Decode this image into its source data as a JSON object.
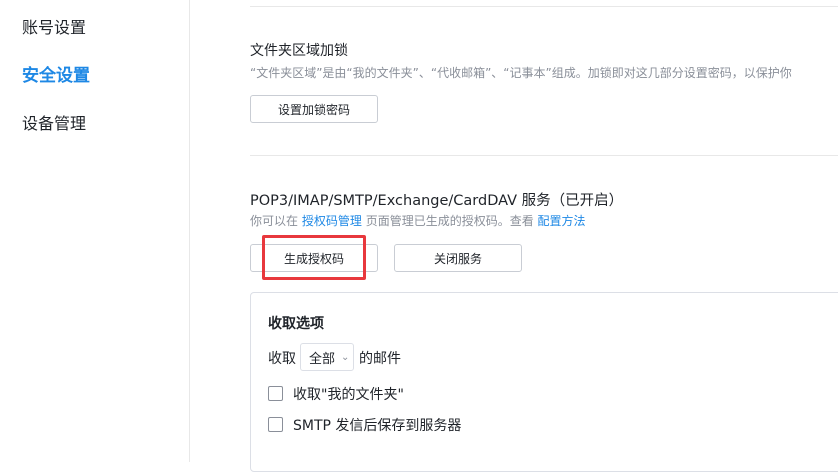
{
  "sidebar": {
    "items": [
      {
        "label": "账号设置"
      },
      {
        "label": "安全设置"
      },
      {
        "label": "设备管理"
      }
    ],
    "active_color": "#1e88e5"
  },
  "folder_lock": {
    "title": "文件夹区域加锁",
    "description": "“文件夹区域”是由“我的文件夹”、“代收邮箱”、“记事本”组成。加锁即对这几部分设置密码，以保护你",
    "button_label": "设置加锁密码"
  },
  "pop_service": {
    "title": "POP3/IMAP/SMTP/Exchange/CardDAV 服务（已开启）",
    "desc_prefix": "你可以在",
    "desc_link1": "授权码管理",
    "desc_middle": "页面管理已生成的授权码。查看",
    "desc_link2": "配置方法",
    "generate_button": "生成授权码",
    "close_button": "关闭服务",
    "highlight_color": "#e8383d"
  },
  "receive_options": {
    "title": "收取选项",
    "receive_label": "收取",
    "select_value": "全部",
    "suffix": "的邮件",
    "checkbox1_label": "收取\"我的文件夹\"",
    "checkbox2_label": "SMTP 发信后保存到服务器"
  }
}
